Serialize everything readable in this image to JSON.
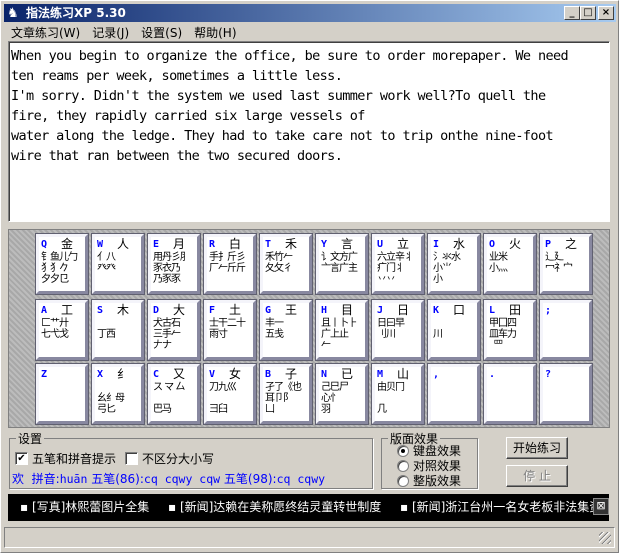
{
  "window": {
    "title": "指法练习XP 5.30",
    "min": "_",
    "max": "□",
    "close": "×"
  },
  "menu": [
    "文章练习(W)",
    "记录(J)",
    "设置(S)",
    "帮助(H)"
  ],
  "text": "When you begin to organize the office, be sure to order morepaper. We need\nten reams per week, sometimes a little less.\nI'm sorry. Didn't the system we used last summer work well?To quell the\nfire, they rapidly carried six large vessels of\nwater along the ledge. They had to take care not to trip onthe nine-foot\nwire that ran between the two secured doors.",
  "keyboard": [
    [
      {
        "k": "Q",
        "m": "金",
        "r": "钅鱼儿勹\n犭犭𠂊\n夕夕㔾"
      },
      {
        "k": "W",
        "m": "人",
        "r": "亻八\n癶癶"
      },
      {
        "k": "E",
        "m": "月",
        "r": "用丹彡⺼\n豕衣乃\n乃豕豕"
      },
      {
        "k": "R",
        "m": "白",
        "r": "手扌斤彡\n厂𠂉斤斤"
      },
      {
        "k": "T",
        "m": "禾",
        "r": "禾竹𠂉\n夂攵彳"
      },
      {
        "k": "Y",
        "m": "言",
        "r": "讠文方广\n亠言广主"
      },
      {
        "k": "U",
        "m": "立",
        "r": "六立辛丬\n疒门丬\n丷丷"
      },
      {
        "k": "I",
        "m": "水",
        "r": "氵氺水\n小⺌\n小"
      },
      {
        "k": "O",
        "m": "火",
        "r": "业米\n小灬"
      },
      {
        "k": "P",
        "m": "之",
        "r": "辶廴\n冖礻宀"
      }
    ],
    [
      {
        "k": "A",
        "m": "工",
        "r": "匚艹廾\n七弋戈"
      },
      {
        "k": "S",
        "m": "木",
        "r": "\n丁西"
      },
      {
        "k": "D",
        "m": "大",
        "r": "犬古石\n三手𠂉\n𠂇ナ"
      },
      {
        "k": "F",
        "m": "土",
        "r": "士干二十\n雨寸"
      },
      {
        "k": "G",
        "m": "王",
        "r": "丰一\n五戋"
      },
      {
        "k": "H",
        "m": "目",
        "r": "且丨卜⺊\n广上止\n𠂉"
      },
      {
        "k": "J",
        "m": "日",
        "r": "日曰早\n刂川"
      },
      {
        "k": "K",
        "m": "口",
        "r": "\n川"
      },
      {
        "k": "L",
        "m": "田",
        "r": "甲囗四\n皿车力\n  罒"
      },
      {
        "k": ";",
        "m": "",
        "r": ""
      }
    ],
    [
      {
        "k": "Z",
        "m": "",
        "r": ""
      },
      {
        "k": "X",
        "m": "纟",
        "r": "\n幺纟母\n弓匕"
      },
      {
        "k": "C",
        "m": "又",
        "r": "ス マ 厶\n\n巴马"
      },
      {
        "k": "V",
        "m": "女",
        "r": "刀九巛\n\n彐臼"
      },
      {
        "k": "B",
        "m": "子",
        "r": "孑了《也\n耳卩阝\n凵"
      },
      {
        "k": "N",
        "m": "已",
        "r": "己巳尸\n心忄\n羽"
      },
      {
        "k": "M",
        "m": "山",
        "r": "由贝冂\n\n几"
      },
      {
        "k": ",",
        "m": "",
        "r": ""
      },
      {
        "k": ".",
        "m": "",
        "r": ""
      },
      {
        "k": "?",
        "m": "",
        "r": ""
      }
    ]
  ],
  "settings": {
    "legend": "设置",
    "wubi_pinyin": "五笔和拼音提示",
    "wubi_checked": true,
    "case": "不区分大小写",
    "case_checked": false,
    "hint_char": "欢",
    "hint_pinyin_label": "拼音:",
    "hint_pinyin": "huān",
    "hint_w86_label": "五笔(86):",
    "hint_w86": "cq cqwy cqw",
    "hint_w98_label": "五笔(98):",
    "hint_w98": "cq cqwy"
  },
  "layout": {
    "legend": "版面效果",
    "options": [
      "键盘效果",
      "对照效果",
      "整版效果"
    ],
    "selected": 0
  },
  "buttons": {
    "start": "开始练习",
    "stop": "停 止"
  },
  "news": [
    "▪ [写真]林熙蕾图片全集",
    "▪ [新闻]达赖在美称愿终结灵童转世制度",
    "▪ [新闻]浙江台州一名女老板非法集资"
  ],
  "news_close": "⊠"
}
